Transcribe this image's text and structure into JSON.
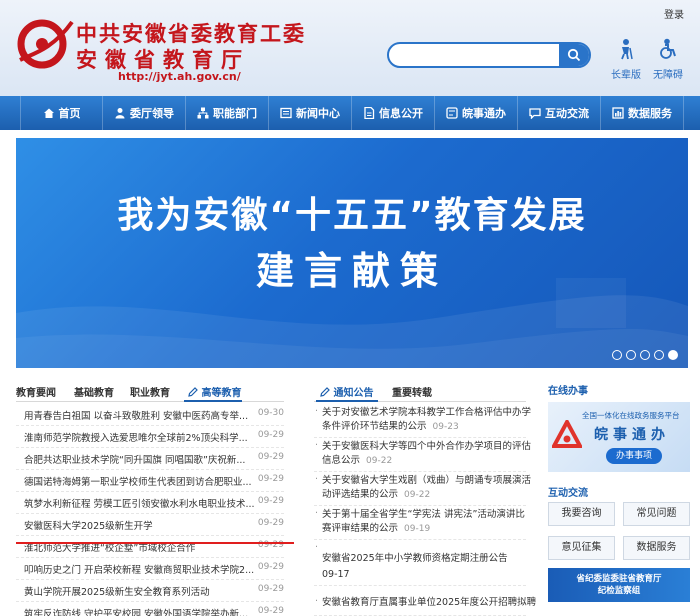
{
  "header": {
    "login": "登录",
    "site_name_line1": "中共安徽省委教育工委",
    "site_name_line2": "安徽省教育厅",
    "site_url": "http://jyt.ah.gov.cn/",
    "search_placeholder": "",
    "tools": [
      {
        "label": "长辈版",
        "icon": "elder-icon"
      },
      {
        "label": "无障碍",
        "icon": "accessibility-icon"
      }
    ]
  },
  "nav": {
    "items": [
      {
        "label": "首页",
        "icon": "home-icon"
      },
      {
        "label": "委厅领导",
        "icon": "leader-icon"
      },
      {
        "label": "职能部门",
        "icon": "org-icon"
      },
      {
        "label": "新闻中心",
        "icon": "news-icon"
      },
      {
        "label": "信息公开",
        "icon": "document-icon"
      },
      {
        "label": "皖事通办",
        "icon": "service-icon"
      },
      {
        "label": "互动交流",
        "icon": "chat-icon"
      },
      {
        "label": "数据服务",
        "icon": "data-icon"
      }
    ]
  },
  "banner": {
    "line1": "我为安徽“十五五”教育发展",
    "line2": "建言献策",
    "slide_count": 5,
    "active_slide": 5
  },
  "left_tabs": [
    "教育要闻",
    "基础教育",
    "职业教育",
    "高等教育"
  ],
  "left_active_tab": "高等教育",
  "left_news": [
    {
      "title": "用青春告白祖国 以奋斗致敬胜利 安徽中医药高专举...",
      "date": "09-30"
    },
    {
      "title": "淮南师范学院教授入选爱思唯尔全球前2%顶尖科学...",
      "date": "09-29"
    },
    {
      "title": "合肥共达职业技术学院“同升国旗 同唱国歌”庆祝新...",
      "date": "09-29"
    },
    {
      "title": "德国诺特海姆第一职业学校师生代表团到访合肥职业...",
      "date": "09-29"
    },
    {
      "title": "筑梦水利新征程 劳模工匠引领安徽水利水电职业技术...",
      "date": "09-29"
    },
    {
      "title": "安徽医科大学2025级新生开学",
      "date": "09-29"
    },
    {
      "title": "淮北师范大学推进“校企墅”市域校企合作",
      "date": "09-29"
    },
    {
      "title": "叩响历史之门 开启荣校新程 安徽商贸职业技术学院2...",
      "date": "09-29"
    },
    {
      "title": "黄山学院开展2025级新生安全教育系列活动",
      "date": "09-29"
    },
    {
      "title": "筑牢反诈防线 守护平安校园 安徽外国语学院举办新...",
      "date": "09-29"
    }
  ],
  "mid_tabs": [
    "通知公告",
    "重要转载"
  ],
  "mid_active_tab": "通知公告",
  "mid_news": [
    {
      "line1": "关于对安徽艺术学院本科教学工作合格评估中办学",
      "line2": "条件评价环节结果的公示",
      "date": "09-23"
    },
    {
      "line1": "关于安徽医科大学等四个中外合作办学项目的评估",
      "line2": "信息公示",
      "date": "09-22"
    },
    {
      "line1": "关于安徽省大学生戏剧（戏曲）与朗诵专项展演活",
      "line2": "动评选结果的公示",
      "date": "09-22"
    },
    {
      "line1": "关于第十届全省学生“学宪法 讲宪法”活动演讲比",
      "line2": "赛评审结果的公示",
      "date": "09-19"
    },
    {
      "line1": "安徽省2025年中小学教师资格定期注册公告",
      "line2": "",
      "date": "09-17"
    },
    {
      "line1": "安徽省教育厅直属事业单位2025年度公开招聘拟聘",
      "line2": "",
      "date": ""
    }
  ],
  "right": {
    "online_title": "在线办事",
    "online_banner": {
      "line1": "全国一体化在线政务服务平台",
      "line2": "皖事通办",
      "button": "办事事项"
    },
    "interact_title": "互动交流",
    "buttons": [
      "我要咨询",
      "常见问题",
      "意见征集",
      "数据服务"
    ],
    "jiwei": {
      "line1": "省纪委监委驻省教育厅",
      "line2": "纪检监察组"
    }
  },
  "colors": {
    "brand_red": "#c4161c",
    "brand_blue": "#1c5fae",
    "nav_blue": "#2f7fd3"
  }
}
